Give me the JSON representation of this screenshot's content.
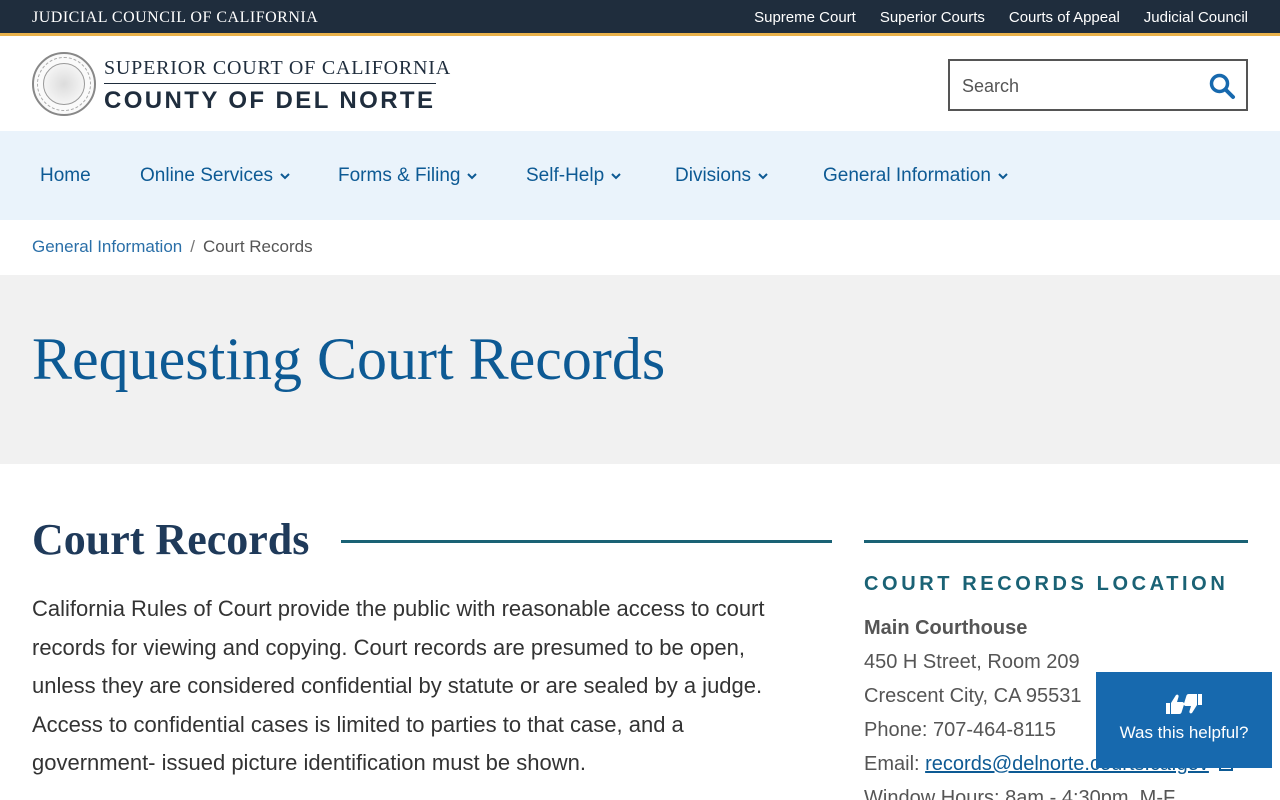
{
  "topbar": {
    "brand": "JUDICIAL COUNCIL OF CALIFORNIA",
    "links": [
      "Supreme Court",
      "Superior Courts",
      "Courts of Appeal",
      "Judicial Council"
    ]
  },
  "header": {
    "title_line1": "SUPERIOR COURT OF CALIFORNIA",
    "title_line2": "COUNTY OF DEL NORTE",
    "search_placeholder": "Search"
  },
  "nav": {
    "items": [
      "Home",
      "Online Services",
      "Forms & Filing",
      "Self-Help",
      "Divisions",
      "General Information"
    ]
  },
  "breadcrumb": {
    "parent": "General Information",
    "separator": "/",
    "current": "Court Records"
  },
  "hero": {
    "title": "Requesting Court Records"
  },
  "content": {
    "section_title": "Court Records",
    "lines": [
      "California Rules of Court provide the public with reasonable access to court",
      "records for viewing and copying. Court records are presumed to be open,",
      "unless they are considered confidential by statute or are sealed by a judge.",
      "Access to confidential cases is limited to parties to that case, and a",
      "government- issued picture identification must be shown."
    ]
  },
  "sidebar": {
    "heading": "COURT RECORDS LOCATION",
    "name": "Main Courthouse",
    "address1": "450 H Street, Room 209",
    "address2": "Crescent City, CA 95531",
    "phone": "Phone: 707-464-8115",
    "email_label": "Email: ",
    "email": "records@delnorte.courts.ca.gov",
    "hours": "Window Hours: 8am - 4:30pm, M-F"
  },
  "feedback": {
    "label": "Was this helpful?"
  },
  "colors": {
    "topbar_bg": "#1f2d3d",
    "accent_gold": "#e8b14a",
    "link_blue": "#0d5a94",
    "nav_bg": "#eaf3fb",
    "rule_teal": "#1a6275",
    "helpful_bg": "#1769ae"
  }
}
